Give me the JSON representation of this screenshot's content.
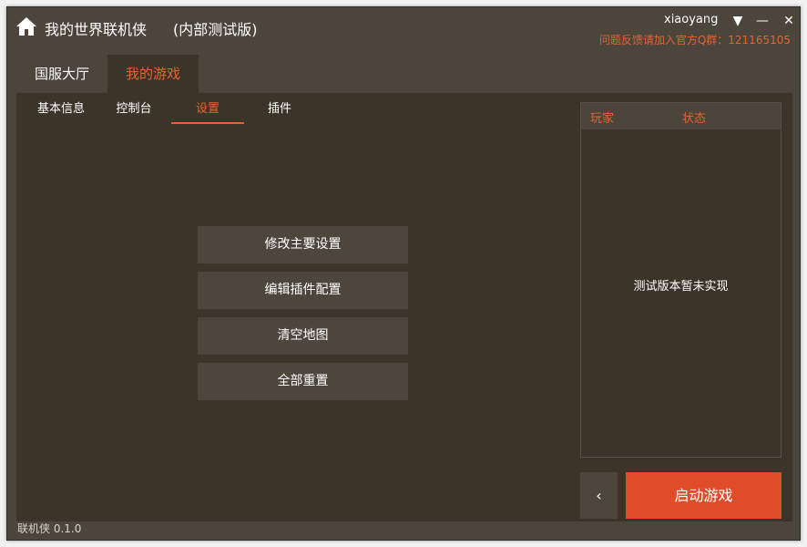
{
  "app": {
    "title": "我的世界联机侠",
    "edition": "(内部测试版)",
    "version": "联机侠 0.1.0"
  },
  "user": {
    "name": "xiaoyang",
    "feedback": "问题反馈请加入官方Q群：121165105"
  },
  "window_controls": {
    "menu": "▼",
    "minimize": "—",
    "close": "✕"
  },
  "main_tabs": [
    {
      "label": "国服大厅",
      "active": false
    },
    {
      "label": "我的游戏",
      "active": true
    }
  ],
  "sub_tabs": [
    {
      "label": "基本信息",
      "active": false
    },
    {
      "label": "控制台",
      "active": false
    },
    {
      "label": "设置",
      "active": true
    },
    {
      "label": "插件",
      "active": false
    }
  ],
  "settings_actions": [
    {
      "label": "修改主要设置"
    },
    {
      "label": "编辑插件配置"
    },
    {
      "label": "清空地图"
    },
    {
      "label": "全部重置"
    }
  ],
  "players_panel": {
    "col_player": "玩家",
    "col_status": "状态",
    "empty_message": "测试版本暂未实现"
  },
  "footer": {
    "back_label": "‹",
    "launch_label": "启动游戏"
  },
  "colors": {
    "accent": "#e8632e",
    "launch": "#e04c2a",
    "window_bg": "#4b453c",
    "content_bg": "#3b3529"
  },
  "icons": {
    "home": "home-icon"
  }
}
